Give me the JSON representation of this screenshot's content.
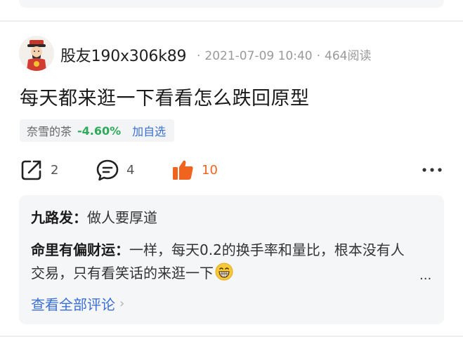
{
  "post": {
    "username": "股友190x306k89",
    "date": "2021-07-09 10:40",
    "reads": "464阅读",
    "separator": "·",
    "text": "每天都来逛一下看看怎么跌回原型"
  },
  "stock": {
    "name": "奈雪的茶",
    "change": "-4.60%",
    "add_label": "加自选",
    "change_color": "#2eaa5a"
  },
  "actions": {
    "share_count": "2",
    "comment_count": "4",
    "like_count": "10",
    "like_color": "#f06420"
  },
  "comments": [
    {
      "author": "九路发：",
      "text": "做人要厚道"
    },
    {
      "author": "命里有偏财运：",
      "text": "一样，每天0.2的换手率和量比，根本没有人交易，只有看笑话的来逛一下",
      "emoji": "grinning-face"
    }
  ],
  "comments_more": "...",
  "view_all_label": "查看全部评论",
  "icons": {
    "share": "share-icon",
    "comment": "comment-icon",
    "like": "thumbs-up-icon",
    "more": "more-dots-icon",
    "chevron": "chevron-right-icon"
  }
}
